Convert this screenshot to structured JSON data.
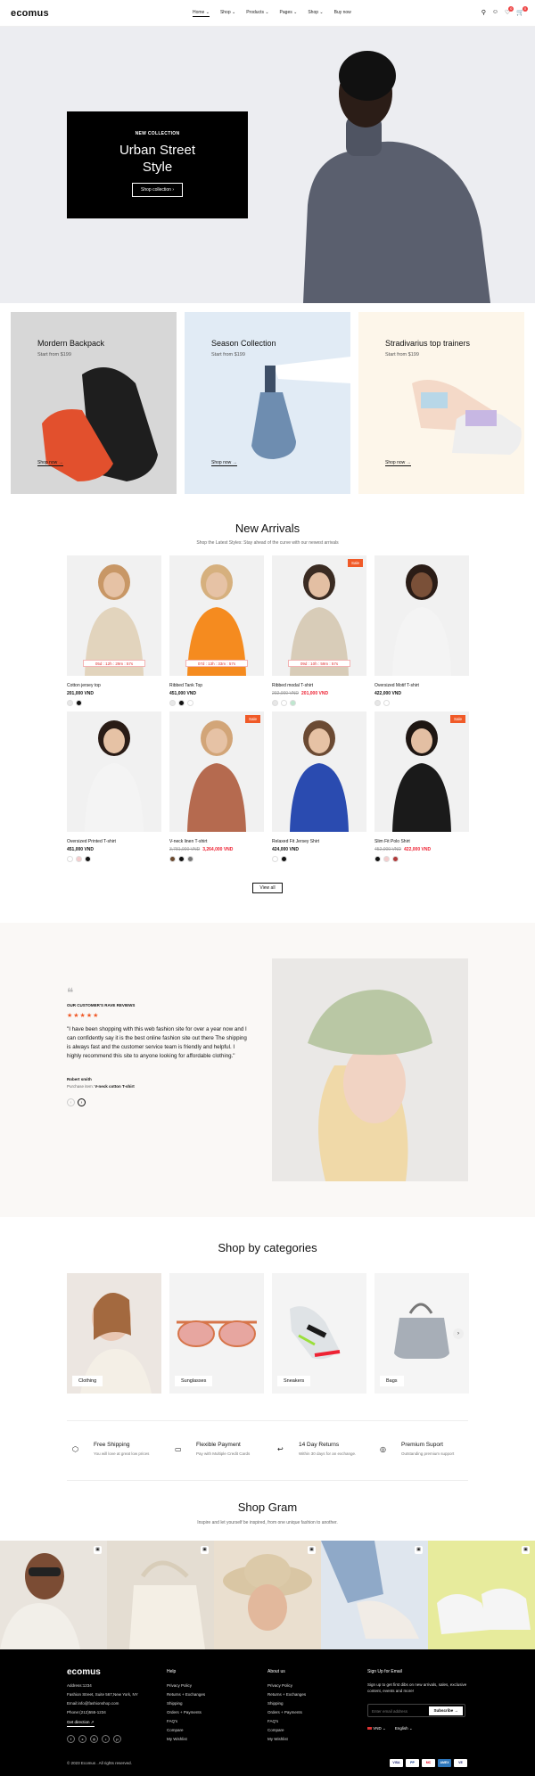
{
  "header": {
    "logo": "ecomus",
    "nav": [
      "Home",
      "Shop",
      "Products",
      "Pages",
      "Shop",
      "Buy now"
    ],
    "cart_count": "0",
    "wish_count": "0"
  },
  "hero": {
    "eyebrow": "NEW COLLECTION",
    "title": "Urban Street Style",
    "button": "Shop collection"
  },
  "promos": [
    {
      "title": "Mordern Backpack",
      "sub": "Start from $199",
      "cta": "Shop now"
    },
    {
      "title": "Season Collection",
      "sub": "Start from $199",
      "cta": "Shop now"
    },
    {
      "title": "Stradivarius top trainers",
      "sub": "Start from $199",
      "cta": "Shop now"
    }
  ],
  "arrivals": {
    "title": "New Arrivals",
    "subtitle": "Shop the Latest Styles: Stay ahead of the curve with our newest arrivals",
    "view_all": "View all",
    "products": [
      {
        "name": "Cotton jersey top",
        "price": "201,000 VND",
        "old": "",
        "sale": "",
        "countdown": "05d : 12h : 29m : 57s",
        "swatches": [
          "#e7e7e7",
          "#111111"
        ]
      },
      {
        "name": "Ribbed Tank Top",
        "price": "451,000 VND",
        "old": "",
        "sale": "",
        "countdown": "07d : 13h : 33m : 57s",
        "swatches": [
          "#e7e7e7",
          "#111111",
          "#ffffff"
        ]
      },
      {
        "name": "Ribbed modal T-shirt",
        "price": "201,000 VND",
        "old": "202,000 VND",
        "sale": "Sale",
        "countdown": "09d : 10h : 59m : 57s",
        "swatches": [
          "#e7e7e7",
          "#ffffff",
          "#bfe7cf"
        ]
      },
      {
        "name": "Oversized Motif T-shirt",
        "price": "422,000 VND",
        "old": "",
        "sale": "",
        "countdown": "",
        "swatches": [
          "#e7e7e7",
          "#ffffff"
        ]
      },
      {
        "name": "Oversized Printed T-shirt",
        "price": "451,000 VND",
        "old": "",
        "sale": "",
        "countdown": "",
        "swatches": [
          "#ffffff",
          "#f4cccc",
          "#111111"
        ]
      },
      {
        "name": "V-neck linen T-shirt",
        "price": "3,264,000 VND",
        "old": "3,781,000 VND",
        "sale": "Sale",
        "countdown": "",
        "swatches": [
          "#6b4a2f",
          "#111111",
          "#777777"
        ]
      },
      {
        "name": "Relaxed Fit Jersey Shirt",
        "price": "424,000 VND",
        "old": "",
        "sale": "",
        "countdown": "",
        "swatches": [
          "#ffffff",
          "#111111"
        ]
      },
      {
        "name": "Slim Fit Polo Shirt",
        "price": "422,000 VND",
        "old": "452,000 VND",
        "sale": "Sale",
        "countdown": "",
        "swatches": [
          "#111111",
          "#f4cccc",
          "#b23a3a"
        ]
      }
    ]
  },
  "testimonial": {
    "eyebrow": "OUR CUSTOMER'S RAVE REVIEWS",
    "stars": "★★★★★",
    "quote": "\"I have been shopping with this web fashion site for over a year now and I can confidently say it is the best online fashion site out there The shipping is always fast and the customer service team is friendly and helpful. I highly recommend this site to anyone looking for affordable clothing.\"",
    "author": "Robert smith",
    "purchase_label": "Purchase item:",
    "purchase_item": "V-neck cotton T-shirt"
  },
  "categories": {
    "title": "Shop by categories",
    "items": [
      "Clothing",
      "Sunglasses",
      "Sneakers",
      "Bags"
    ]
  },
  "features": [
    {
      "title": "Free Shipping",
      "desc": "You will love at great low prices"
    },
    {
      "title": "Flexible Payment",
      "desc": "Pay with Multiple Credit Cards"
    },
    {
      "title": "14 Day Returns",
      "desc": "Within 30 days for an exchange."
    },
    {
      "title": "Premium Suport",
      "desc": "Outstanding premium support"
    }
  ],
  "gram": {
    "title": "Shop Gram",
    "subtitle": "Inspire and let yourself be inspired, from one unique fashion to another."
  },
  "footer": {
    "logo": "ecomus",
    "address_lines": [
      "Address:1234",
      "Fashion Street, Suite 567,New York, NY",
      "Email:info@fashionshop.com",
      "Phone:(212)555-1234"
    ],
    "directions": "Get direction",
    "help_title": "Help",
    "help_links": [
      "Privacy Policy",
      "Returns + Exchanges",
      "Shipping",
      "Orders + Payments",
      "FAQ's",
      "Compare",
      "My Wishlist"
    ],
    "about_title": "About us",
    "about_links": [
      "Privacy Policy",
      "Returns + Exchanges",
      "Shipping",
      "Orders + Payments",
      "FAQ's",
      "Compare",
      "My Wishlist"
    ],
    "signup_title": "Sign Up for Email",
    "signup_text": "Sign up to get first dibs on new arrivals, sales, exclusive content, events and more!",
    "email_placeholder": "Enter email address",
    "subscribe": "Subscribe",
    "currency": "VND",
    "language": "English",
    "copyright": "© 2023 Ecomus . All rights reserved.",
    "payments": [
      "VISA",
      "PP",
      "MC",
      "AMEX",
      "VE"
    ]
  }
}
